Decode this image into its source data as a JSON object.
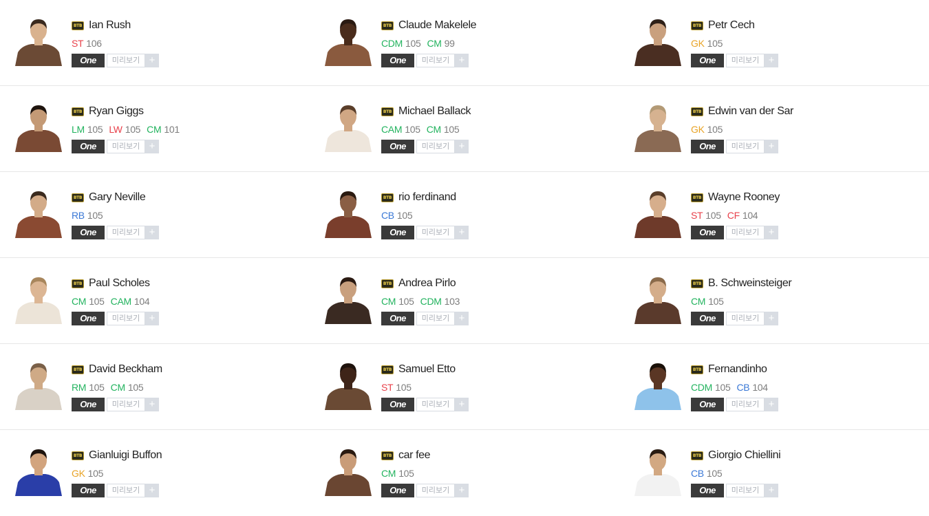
{
  "colors": {
    "forward": "#e8404a",
    "midfield": "#22b35e",
    "defender": "#3a78d6",
    "goalkeeper": "#e8a325",
    "ovr": "#7d7d7d"
  },
  "season_badge": "BTB",
  "buttons": {
    "one": "One",
    "preview": "미리보기",
    "add": "+"
  },
  "players": [
    {
      "name": "Ian Rush",
      "kit": "#6b4a35",
      "skin": "#d9b28e",
      "hair": "#3a2a1e",
      "positions": [
        {
          "pos": "ST",
          "ovr": "106",
          "group": "forward"
        }
      ]
    },
    {
      "name": "Claude Makelele",
      "kit": "#8a5a3e",
      "skin": "#4a2c1c",
      "hair": "#2a1a12",
      "positions": [
        {
          "pos": "CDM",
          "ovr": "105",
          "group": "midfield"
        },
        {
          "pos": "CM",
          "ovr": "99",
          "group": "midfield"
        }
      ]
    },
    {
      "name": "Petr Cech",
      "kit": "#4a2e22",
      "skin": "#c9a07e",
      "hair": "#2e2018",
      "positions": [
        {
          "pos": "GK",
          "ovr": "105",
          "group": "goalkeeper"
        }
      ]
    },
    {
      "name": "Ryan Giggs",
      "kit": "#7a4a34",
      "skin": "#c49a76",
      "hair": "#1e140e",
      "positions": [
        {
          "pos": "LM",
          "ovr": "105",
          "group": "midfield"
        },
        {
          "pos": "LW",
          "ovr": "105",
          "group": "forward"
        },
        {
          "pos": "CM",
          "ovr": "101",
          "group": "midfield"
        }
      ]
    },
    {
      "name": "Michael Ballack",
      "kit": "#eee6dc",
      "skin": "#d0a784",
      "hair": "#5a3e2a",
      "positions": [
        {
          "pos": "CAM",
          "ovr": "105",
          "group": "midfield"
        },
        {
          "pos": "CM",
          "ovr": "105",
          "group": "midfield"
        }
      ]
    },
    {
      "name": "Edwin van der Sar",
      "kit": "#8a6a54",
      "skin": "#d6b290",
      "hair": "#b39a76",
      "positions": [
        {
          "pos": "GK",
          "ovr": "105",
          "group": "goalkeeper"
        }
      ]
    },
    {
      "name": "Gary Neville",
      "kit": "#8a4a32",
      "skin": "#d3ab88",
      "hair": "#3a2a1e",
      "positions": [
        {
          "pos": "RB",
          "ovr": "105",
          "group": "defender"
        }
      ]
    },
    {
      "name": "rio ferdinand",
      "kit": "#7a3e2c",
      "skin": "#8a5e44",
      "hair": "#2a1a10",
      "positions": [
        {
          "pos": "CB",
          "ovr": "105",
          "group": "defender"
        }
      ]
    },
    {
      "name": "Wayne Rooney",
      "kit": "#6e3a2a",
      "skin": "#d6ae8c",
      "hair": "#5a3e2a",
      "positions": [
        {
          "pos": "ST",
          "ovr": "105",
          "group": "forward"
        },
        {
          "pos": "CF",
          "ovr": "104",
          "group": "forward"
        }
      ]
    },
    {
      "name": "Paul Scholes",
      "kit": "#ece4d8",
      "skin": "#dcb694",
      "hair": "#a8865c",
      "positions": [
        {
          "pos": "CM",
          "ovr": "105",
          "group": "midfield"
        },
        {
          "pos": "CAM",
          "ovr": "104",
          "group": "midfield"
        }
      ]
    },
    {
      "name": "Andrea Pirlo",
      "kit": "#3a2a22",
      "skin": "#c9a07e",
      "hair": "#2a1a12",
      "positions": [
        {
          "pos": "CM",
          "ovr": "105",
          "group": "midfield"
        },
        {
          "pos": "CDM",
          "ovr": "103",
          "group": "midfield"
        }
      ]
    },
    {
      "name": "B. Schweinsteiger",
      "kit": "#5a3a2c",
      "skin": "#d4ad8a",
      "hair": "#8a6a4a",
      "positions": [
        {
          "pos": "CM",
          "ovr": "105",
          "group": "midfield"
        }
      ]
    },
    {
      "name": "David Beckham",
      "kit": "#d9d1c6",
      "skin": "#cfaa86",
      "hair": "#7a6048",
      "positions": [
        {
          "pos": "RM",
          "ovr": "105",
          "group": "midfield"
        },
        {
          "pos": "CM",
          "ovr": "105",
          "group": "midfield"
        }
      ]
    },
    {
      "name": "Samuel Etto",
      "kit": "#6a4a34",
      "skin": "#3e2418",
      "hair": "#1e120c",
      "positions": [
        {
          "pos": "ST",
          "ovr": "105",
          "group": "forward"
        }
      ]
    },
    {
      "name": "Fernandinho",
      "kit": "#8ec2ea",
      "skin": "#5a3624",
      "hair": "#1a1008",
      "positions": [
        {
          "pos": "CDM",
          "ovr": "105",
          "group": "midfield"
        },
        {
          "pos": "CB",
          "ovr": "104",
          "group": "defender"
        }
      ]
    },
    {
      "name": "Gianluigi Buffon",
      "kit": "#2a3ea8",
      "skin": "#d2a47e",
      "hair": "#1e140e",
      "positions": [
        {
          "pos": "GK",
          "ovr": "105",
          "group": "goalkeeper"
        }
      ]
    },
    {
      "name": "car fee",
      "kit": "#6a4632",
      "skin": "#c99c78",
      "hair": "#2a1a10",
      "positions": [
        {
          "pos": "CM",
          "ovr": "105",
          "group": "midfield"
        }
      ]
    },
    {
      "name": "Giorgio Chiellini",
      "kit": "#f2f2f2",
      "skin": "#d2a882",
      "hair": "#2a1c12",
      "positions": [
        {
          "pos": "CB",
          "ovr": "105",
          "group": "defender"
        }
      ]
    }
  ]
}
